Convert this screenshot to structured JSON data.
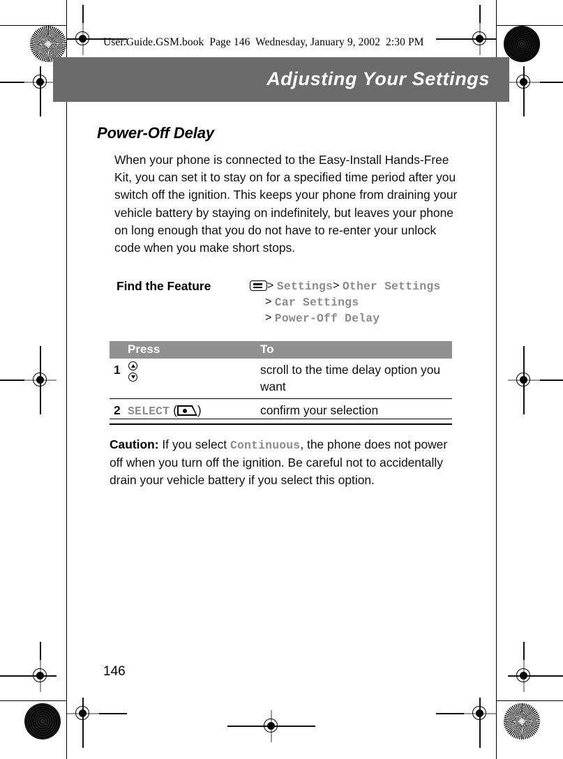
{
  "document": {
    "running_head": "User.Guide.GSM.book  Page 146  Wednesday, January 9, 2002  2:30 PM",
    "chapter_title": "Adjusting Your Settings",
    "section_title": "Power-Off Delay",
    "page_number": "146"
  },
  "intro_paragraph": "When your phone is connected to the Easy-Install Hands-Free Kit, you can set it to stay on for a specified time period after you switch off the ignition. This keeps your phone from draining your vehicle battery by staying on indefinitely, but leaves your phone on long enough that you do not have to re-enter your unlock code when you make short stops.",
  "find_the_feature": {
    "label": "Find the Feature",
    "menu_icon": "menu-key-icon",
    "separator": ">",
    "line1_items": [
      "Settings",
      "Other Settings"
    ],
    "line2_item": "Car Settings",
    "line3_item": "Power-Off Delay"
  },
  "steps_table": {
    "headers": {
      "number": "",
      "press": "Press",
      "to": "To"
    },
    "rows": [
      {
        "number": "1",
        "press_icon": "scroll-key-icon",
        "press_text": "",
        "to": "scroll to the time delay option you want"
      },
      {
        "number": "2",
        "press_icon": "softkey-icon",
        "press_text": "SELECT",
        "press_paren_open": "(",
        "press_paren_close": ")",
        "to": "confirm your selection"
      }
    ]
  },
  "caution": {
    "lead": "Caution:",
    "text_before": " If you select ",
    "mono_term": "Continuous",
    "text_after": ", the phone does not power off when you turn off the ignition. Be careful not to accidentally drain your vehicle battery if you select this option."
  },
  "colors": {
    "chapter_bar": "#6b6b6b",
    "table_header": "#919191",
    "mono_gray": "#8c8c8c",
    "page_background": "#ffffff"
  }
}
